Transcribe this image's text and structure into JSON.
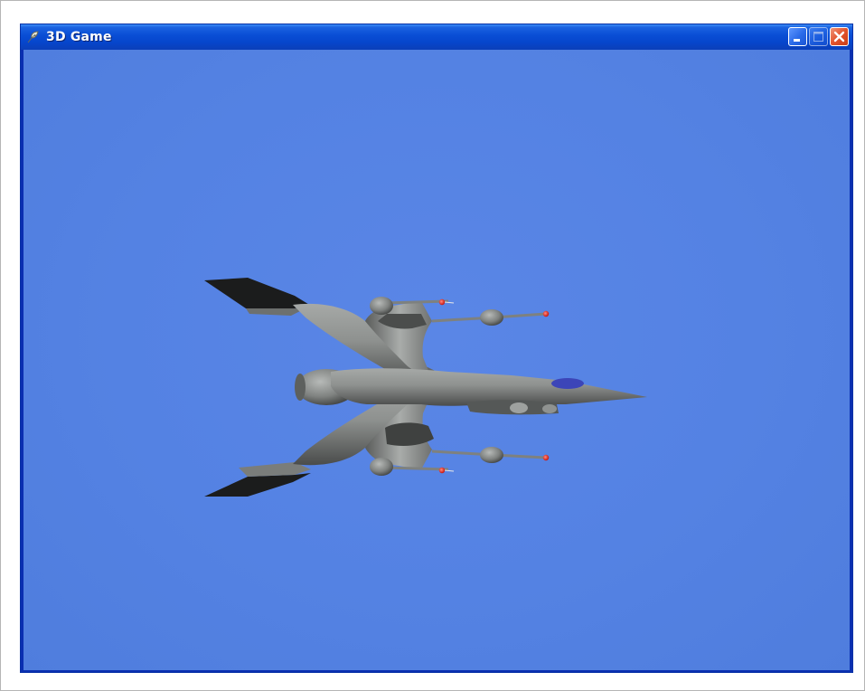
{
  "window": {
    "title": "3D Game",
    "icon": "feather-app-icon",
    "buttons": {
      "minimize": "minimize-icon",
      "maximize": "maximize-icon",
      "close": "close-icon"
    }
  },
  "scene": {
    "sky_color": "#5482e3",
    "ship_color": "#8a8d8c",
    "canopy_color": "#3c45b8",
    "light_color": "#e0201a"
  }
}
